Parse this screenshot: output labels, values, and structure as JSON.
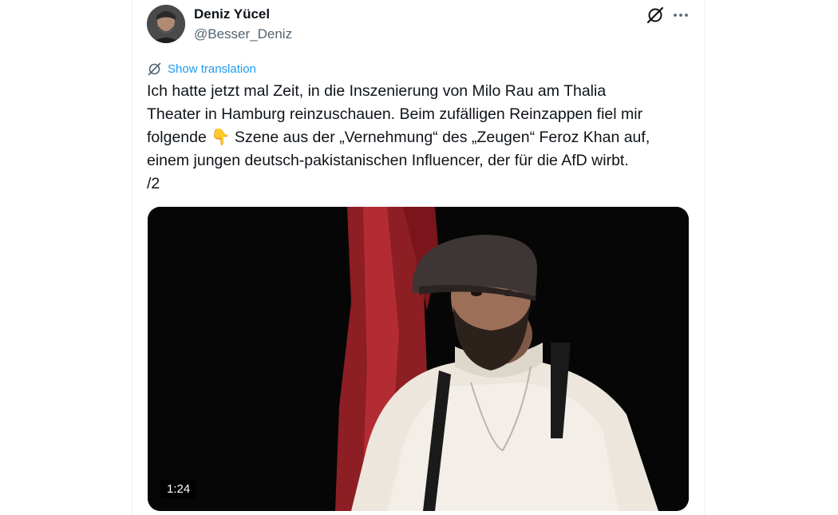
{
  "author": {
    "display_name": "Deniz Yücel",
    "handle": "@Besser_Deniz"
  },
  "icons": {
    "grok": "grok-icon",
    "more": "more-icon",
    "translate": "translate-icon"
  },
  "translation": {
    "label": "Show translation"
  },
  "tweet": {
    "text": "Ich hatte jetzt mal Zeit, in die Inszenierung von Milo Rau am Thalia\nTheater in Hamburg reinzuschauen. Beim zufälligen Reinzappen fiel mir\nfolgende 👇 Szene aus der „Vernehmung“ des „Zeugen“ Feroz Khan auf,\neinem jungen deutsch-pakistanischen Influencer, der für die AfD wirbt.\n/2"
  },
  "media": {
    "type": "video",
    "duration": "1:24"
  },
  "colors": {
    "link": "#1d9bf0",
    "secondary_text": "#536471",
    "primary_text": "#0f1419"
  }
}
